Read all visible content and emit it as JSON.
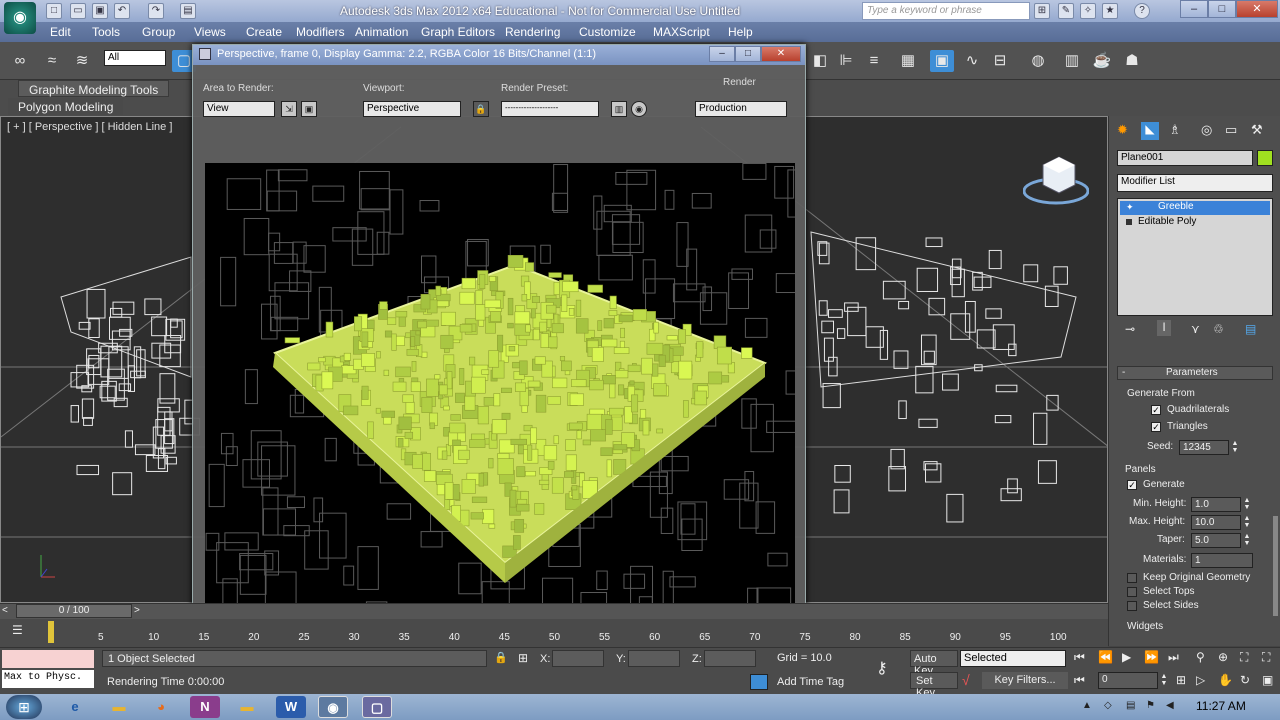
{
  "app": {
    "title": "Autodesk 3ds Max  2012 x64   Educational - Not for Commercial Use    Untitled",
    "search_placeholder": "Type a keyword or phrase",
    "icon": "3ds-max-logo-icon"
  },
  "menu": [
    "Edit",
    "Tools",
    "Group",
    "Views",
    "Create",
    "Modifiers",
    "Animation",
    "Graph Editors",
    "Rendering",
    "Customize",
    "MAXScript",
    "Help"
  ],
  "toolbar": {
    "selection_filter": "All"
  },
  "ribbon": {
    "tab1": "Graphite Modeling Tools",
    "tab2": "Polygon Modeling"
  },
  "viewport": {
    "label": "[ + ] [ Perspective ] [ Hidden Line ]"
  },
  "render_window": {
    "title": "Perspective, frame 0, Display Gamma: 2.2, RGBA Color 16 Bits/Channel (1:1)",
    "area_label": "Area to Render:",
    "area_value": "View",
    "viewport_label": "Viewport:",
    "viewport_value": "Perspective",
    "preset_label": "Render Preset:",
    "preset_value": "--------------------",
    "render_label": "Render",
    "render_value": "Production",
    "accent_color": "#d2e86a"
  },
  "command_panel": {
    "object_name": "Plane001",
    "object_color": "#a0e020",
    "modifier_list": "Modifier List",
    "stack": [
      "Greeble",
      "Editable Poly"
    ],
    "rollout_title": "Parameters",
    "generate_from": "Generate From",
    "quadrilaterals": "Quadrilaterals",
    "triangles": "Triangles",
    "seed_label": "Seed:",
    "seed_value": "12345",
    "panels": "Panels",
    "generate": "Generate",
    "min_height_label": "Min. Height:",
    "min_height_value": "1.0",
    "max_height_label": "Max. Height:",
    "max_height_value": "10.0",
    "taper_label": "Taper:",
    "taper_value": "5.0",
    "materials_label": "Materials:",
    "materials_value": "1",
    "keep_original": "Keep Original Geometry",
    "select_tops": "Select Tops",
    "select_sides": "Select Sides",
    "widgets": "Widgets"
  },
  "timeline": {
    "slider": "0 / 100",
    "ticks": [
      "5",
      "10",
      "15",
      "20",
      "25",
      "30",
      "35",
      "40",
      "45",
      "50",
      "55",
      "60",
      "65",
      "70",
      "75",
      "80",
      "85",
      "90",
      "95",
      "100"
    ]
  },
  "status": {
    "maxscript": "Max to Physc.",
    "selected": "1 Object Selected",
    "rendering_time": "Rendering Time  0:00:00",
    "x_label": "X:",
    "y_label": "Y:",
    "z_label": "Z:",
    "grid": "Grid = 10.0",
    "add_time_tag": "Add Time Tag",
    "auto_key": "Auto Key",
    "selected_dropdown": "Selected",
    "set_key": "Set Key",
    "key_filters": "Key Filters...",
    "frame": "0"
  },
  "taskbar": {
    "clock": "11:27 AM"
  }
}
